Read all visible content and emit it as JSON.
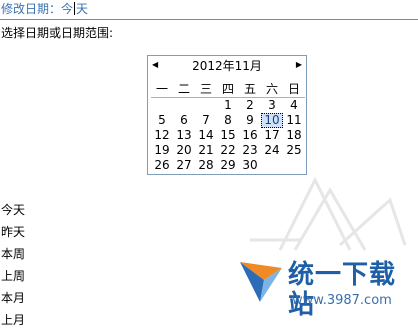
{
  "search": {
    "prefix": "修改日期：",
    "value_before": "今",
    "value_after": "天"
  },
  "range_label": "选择日期或日期范围:",
  "calendar": {
    "month_title": "2012年11月",
    "weekdays": [
      "一",
      "二",
      "三",
      "四",
      "五",
      "六",
      "日"
    ],
    "leading_blanks": 3,
    "days": [
      "1",
      "2",
      "3",
      "4",
      "5",
      "6",
      "7",
      "8",
      "9",
      "10",
      "11",
      "12",
      "13",
      "14",
      "15",
      "16",
      "17",
      "18",
      "19",
      "20",
      "21",
      "22",
      "23",
      "24",
      "25",
      "26",
      "27",
      "28",
      "29",
      "30"
    ],
    "selected_day": "10"
  },
  "quick_ranges": [
    "今天",
    "昨天",
    "本周",
    "上周",
    "本月",
    "上月"
  ],
  "watermark": {
    "text": "统一下载站",
    "url": "www.3987.com"
  },
  "colors": {
    "accent": "#3a72b0",
    "selected_bg": "#cfe2f7",
    "border": "#7f9db9"
  }
}
